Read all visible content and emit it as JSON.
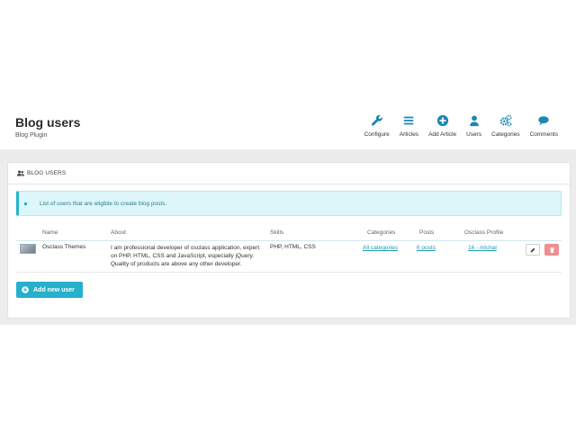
{
  "header": {
    "title": "Blog users",
    "subtitle": "Blog Plugin",
    "nav": [
      {
        "label": "Configure",
        "icon": "wrench-icon"
      },
      {
        "label": "Articles",
        "icon": "list-icon"
      },
      {
        "label": "Add Article",
        "icon": "plus-circle-icon"
      },
      {
        "label": "Users",
        "icon": "user-icon"
      },
      {
        "label": "Categories",
        "icon": "gears-icon"
      },
      {
        "label": "Comments",
        "icon": "comments-icon"
      }
    ]
  },
  "panel": {
    "heading": "BLOG USERS",
    "heading_icon": "users-icon",
    "info": "List of users that are eligible to create blog posts.",
    "columns": [
      "Name",
      "About",
      "Skills",
      "Categories",
      "Posts",
      "Osclass Profile"
    ],
    "rows": [
      {
        "name": "Osclass Themes",
        "about": "I am professional developer of osclass application, expert on PHP, HTML, CSS and JavaScript, especially jQuery. Quality of products are above any other developer.",
        "skills": "PHP, HTML, CSS",
        "categories": "All categories",
        "posts": "6 posts",
        "profile": "16 - michal"
      }
    ],
    "add_button": "Add new user"
  },
  "colors": {
    "accent": "#25b0cb",
    "info_bg": "#ddf6f9",
    "danger": "#ef8f8f",
    "icon": "#1c87b5"
  }
}
